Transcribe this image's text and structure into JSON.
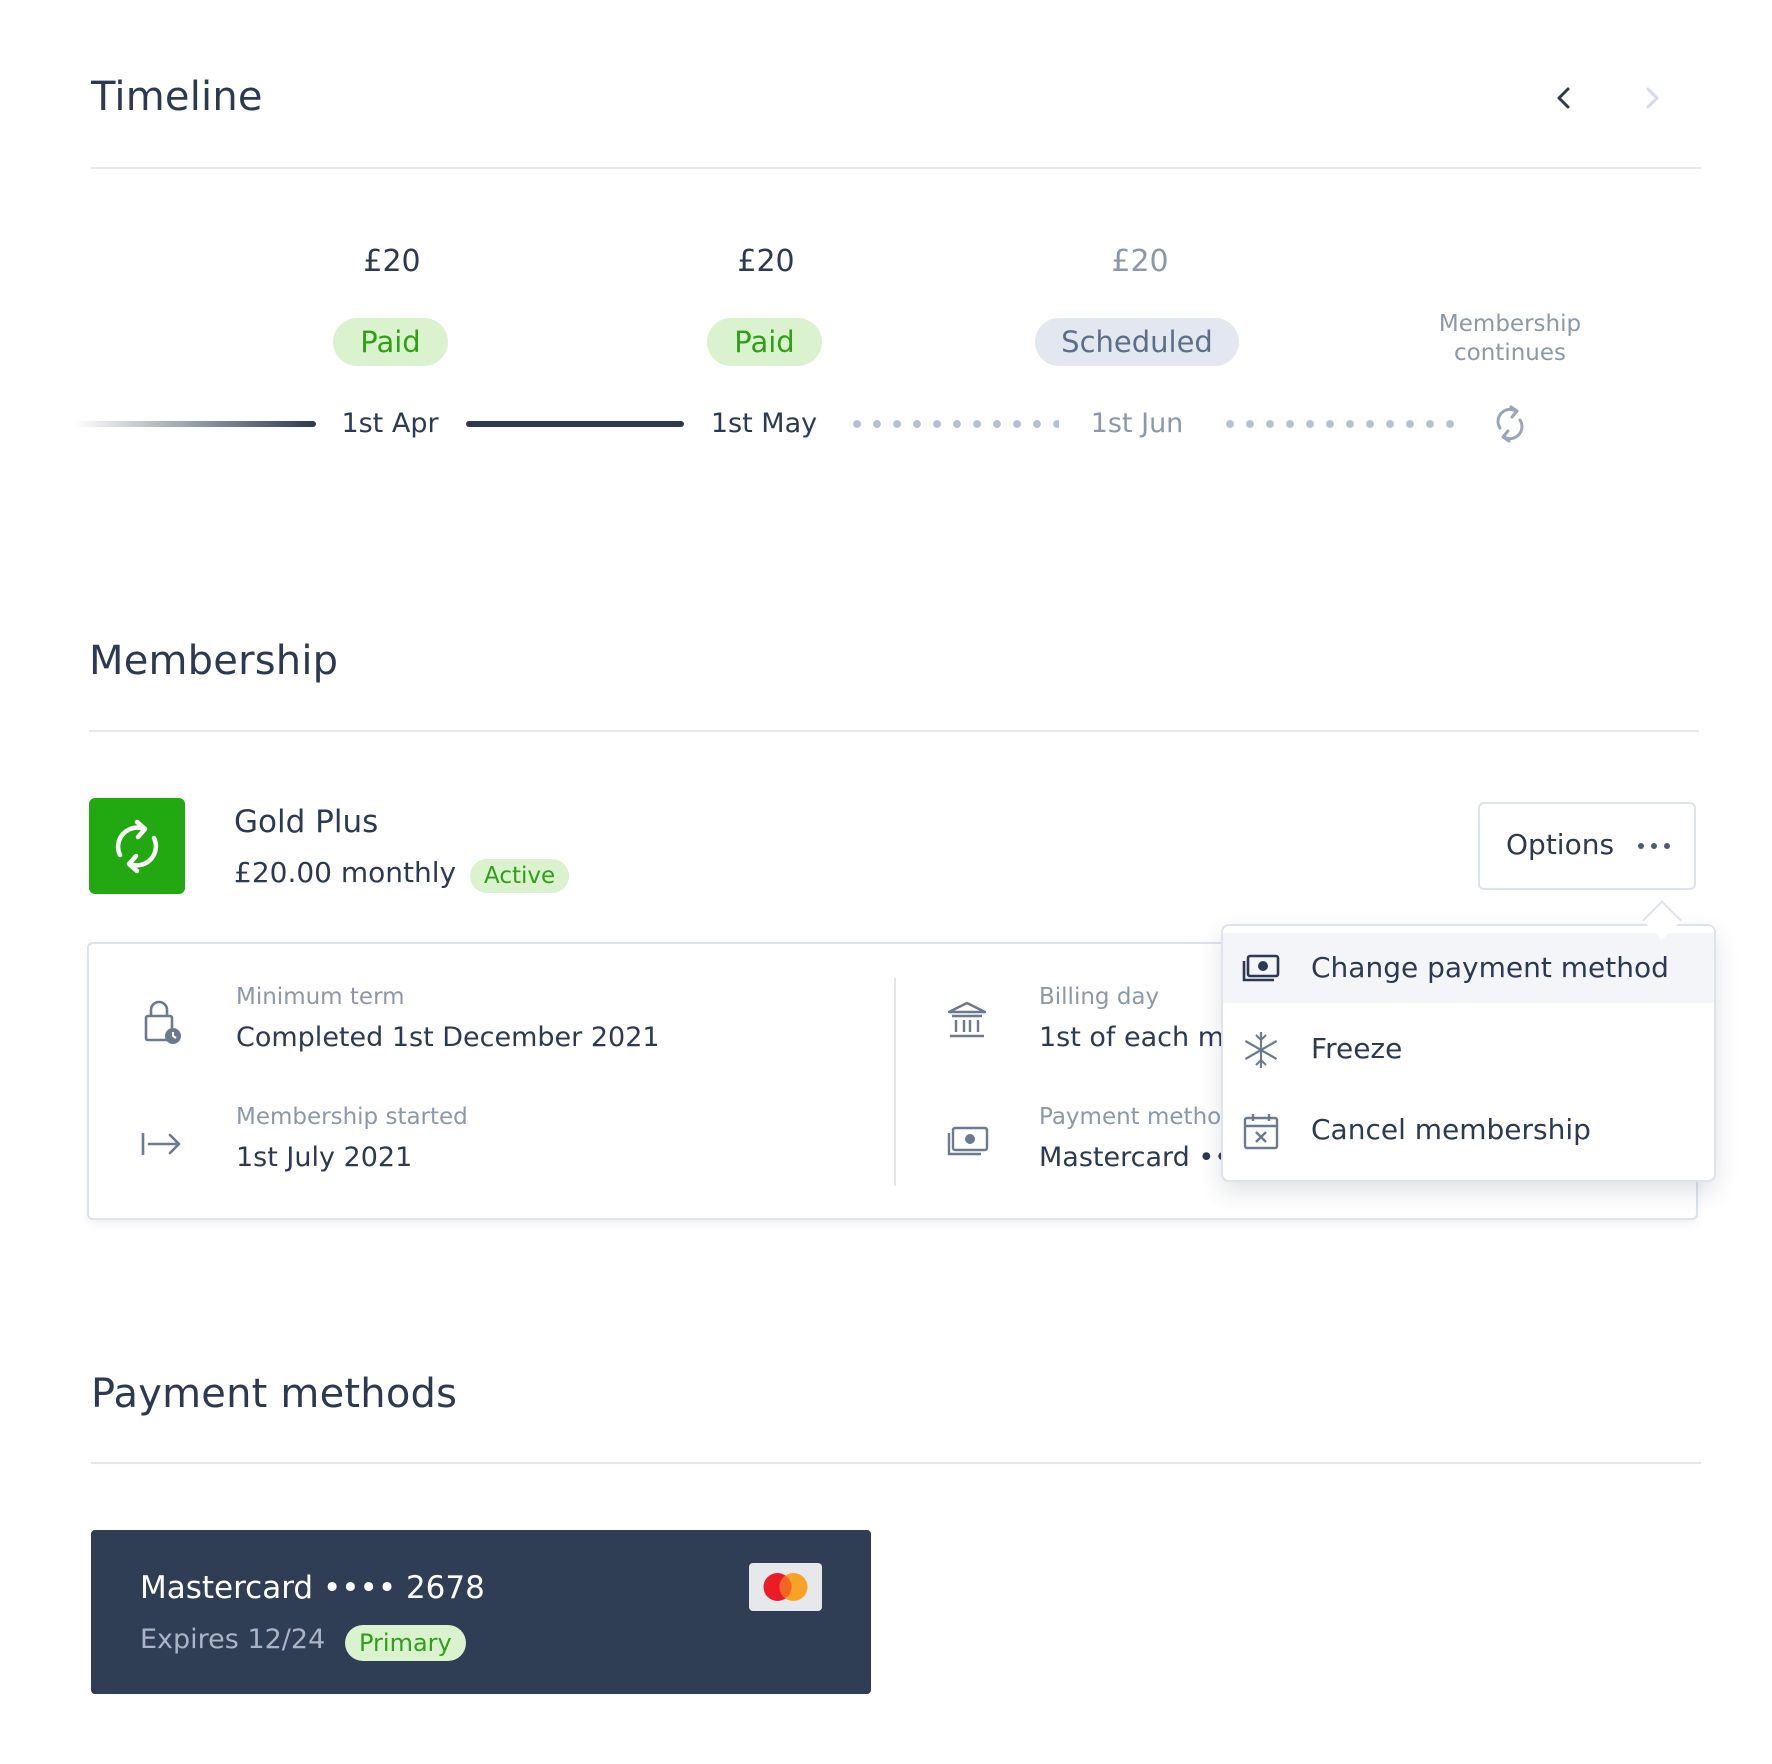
{
  "timeline": {
    "title": "Timeline",
    "prev_label": "Previous",
    "next_label": "Next",
    "entries": [
      {
        "amount": "£20",
        "status": "Paid",
        "date": "1st Apr"
      },
      {
        "amount": "£20",
        "status": "Paid",
        "date": "1st May"
      },
      {
        "amount": "£20",
        "status": "Scheduled",
        "date": "1st Jun"
      }
    ],
    "continues_line1": "Membership",
    "continues_line2": "continues"
  },
  "membership": {
    "title": "Membership",
    "plan_name": "Gold Plus",
    "price": "£20.00 monthly",
    "status": "Active",
    "options_label": "Options",
    "details": {
      "minimum_term_label": "Minimum term",
      "minimum_term_value": "Completed 1st December 2021",
      "started_label": "Membership started",
      "started_value": "1st July 2021",
      "billing_day_label": "Billing day",
      "billing_day_value": "1st of each mo",
      "payment_method_label": "Payment metho",
      "payment_method_value": "Mastercard ••"
    },
    "menu": {
      "change_payment": "Change payment method",
      "freeze": "Freeze",
      "cancel": "Cancel membership"
    }
  },
  "payment_methods": {
    "title": "Payment methods",
    "card": {
      "title": "Mastercard •••• 2678",
      "expires": "Expires 12/24",
      "badge": "Primary"
    }
  },
  "colors": {
    "text_primary": "#2b3a52",
    "text_muted": "#8b98ac",
    "accent_green": "#2ea016",
    "icon_tile_green": "#22a811",
    "pill_green_bg": "#dbf2cf",
    "pill_grey_bg": "#e3e7ef",
    "card_bg": "#2f3d55"
  }
}
